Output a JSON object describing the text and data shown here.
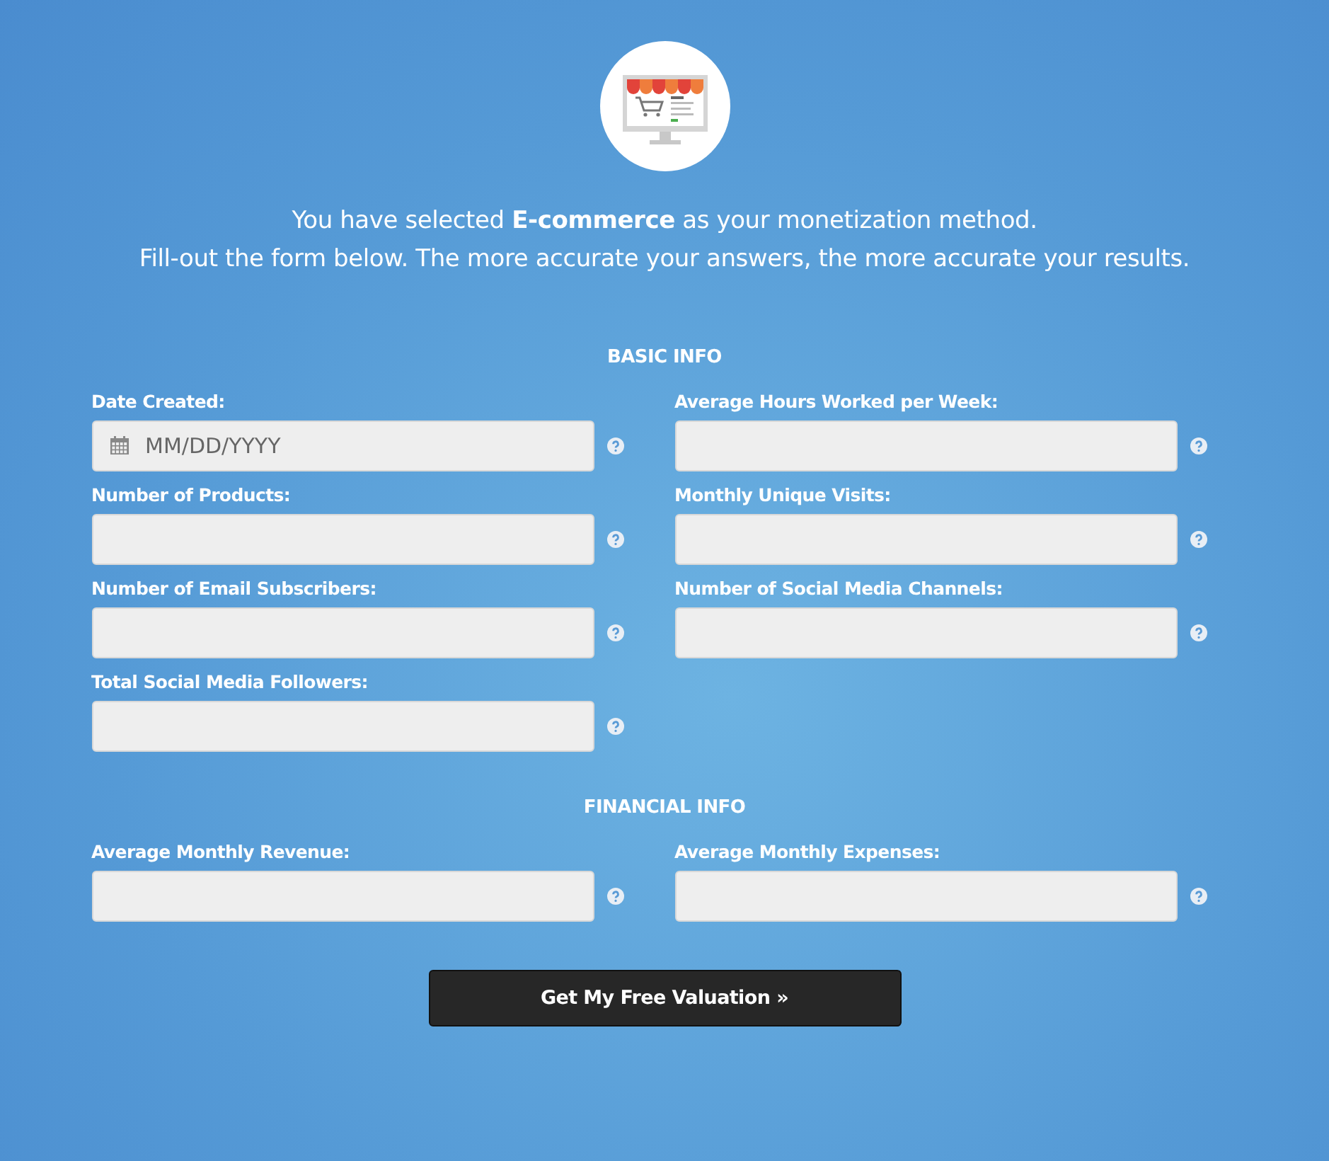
{
  "intro": {
    "line_1": "You have selected **E-commerce** as your monetization method.",
    "line_2": "Fill-out the form below. The more accurate your answers, the more accurate your results."
  },
  "sections": [
    {
      "heading": "BASIC INFO",
      "fields": [
        {
          "label": "Date Created:",
          "kind": "date",
          "placeholder": "MM/DD/YYYY"
        },
        {
          "label": "Average Hours Worked per Week:",
          "kind": "text"
        },
        {
          "label": "Number of Products:",
          "kind": "text"
        },
        {
          "label": "Monthly Unique Visits:",
          "kind": "text"
        },
        {
          "label": "Number of Email Subscribers:",
          "kind": "text"
        },
        {
          "label": "Number of Social Media Channels:",
          "kind": "text"
        },
        {
          "label": "Total Social Media Followers:",
          "kind": "text"
        }
      ]
    },
    {
      "heading": "FINANCIAL INFO",
      "fields": [
        {
          "label": "Average Monthly Revenue:",
          "kind": "text"
        },
        {
          "label": "Average Monthly Expenses:",
          "kind": "text"
        }
      ]
    }
  ],
  "submit": "Get My Free Valuation »"
}
